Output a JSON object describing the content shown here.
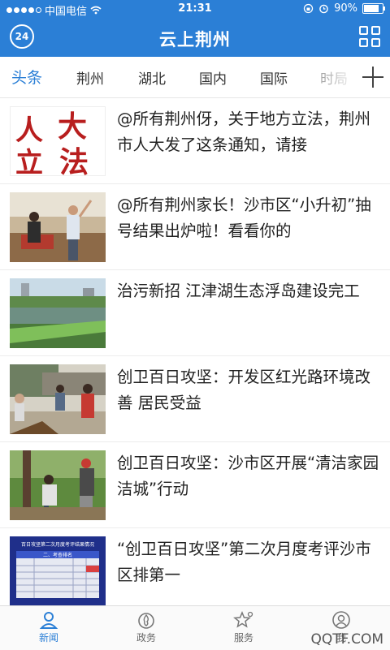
{
  "status": {
    "carrier": "中国电信",
    "time": "21:31",
    "battery": "90%",
    "battery_level": 0.9
  },
  "appbar": {
    "title": "云上荆州",
    "logo_text": "24"
  },
  "tabs": [
    {
      "label": "头条",
      "active": true
    },
    {
      "label": "荆州"
    },
    {
      "label": "湖北"
    },
    {
      "label": "国内"
    },
    {
      "label": "国际"
    },
    {
      "label": "时局"
    }
  ],
  "news": [
    {
      "title": "@所有荆州伢，关于地方立法，荆州市人大发了这条通知，请接",
      "thumb_text": [
        "人",
        "大",
        "立",
        "法"
      ]
    },
    {
      "title": "@所有荆州家长！沙市区“小升初”抽号结果出炉啦！看看你的"
    },
    {
      "title": "治污新招 江津湖生态浮岛建设完工"
    },
    {
      "title": "创卫百日攻坚：开发区红光路环境改善 居民受益"
    },
    {
      "title": "创卫百日攻坚：沙市区开展“清洁家园洁城”行动"
    },
    {
      "title": "“创卫百日攻坚”第二次月度考评沙市区排第一",
      "thumb_text": [
        "百日攻坚第二次月度考评结果情况",
        "二、考查排名"
      ]
    }
  ],
  "tabbar": [
    {
      "label": "新闻",
      "icon": "user-icon",
      "active": true
    },
    {
      "label": "政务",
      "icon": "flame-icon"
    },
    {
      "label": "服务",
      "icon": "star-icon"
    },
    {
      "label": "我",
      "icon": "profile-icon"
    }
  ],
  "watermark": "QQTF.COM",
  "colors": {
    "accent": "#2b7fd6"
  }
}
